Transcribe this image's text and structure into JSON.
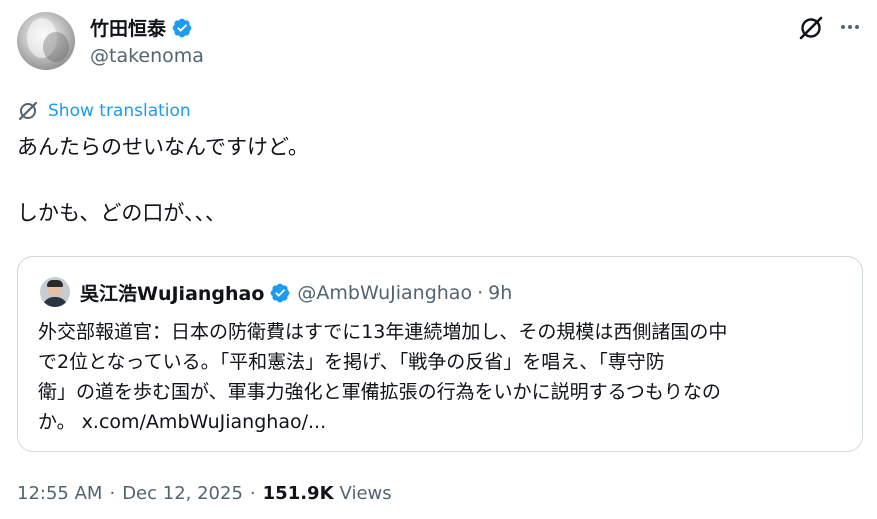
{
  "author": {
    "display_name": "竹田恒泰",
    "handle": "@takenoma"
  },
  "translate": {
    "label": "Show translation"
  },
  "tweet": {
    "line1": "あんたらのせいなんですけど。",
    "line2": "しかも、どの口が、、、"
  },
  "quote": {
    "display_name": "吳江浩WuJianghao",
    "handle": "@AmbWuJianghao",
    "separator": "·",
    "time": "9h",
    "lines": [
      "外交部報道官：日本の防衛費はすでに13年連続増加し、その規模は西側諸国の中",
      "で2位となっている。「平和憲法」を掲げ、「戦争の反省」を唱え、「専守防",
      "衛」の道を歩む国が、軍事力強化と軍備拡張の行為をいかに説明するつもりなの"
    ],
    "last_line_prefix": "か。",
    "link": "x.com/AmbWuJianghao/..."
  },
  "meta": {
    "time": "12:55 AM",
    "separator": "·",
    "date": "Dec 12, 2025",
    "views_count": "151.9K",
    "views_label": "Views"
  },
  "icons": {
    "verified": "verified-badge-icon",
    "grok": "grok-icon",
    "more": "more-icon",
    "translate": "translate-icon"
  },
  "colors": {
    "accent": "#1d9bf0",
    "text": "#0f1419",
    "secondary": "#536471",
    "border": "#cfd9de"
  }
}
